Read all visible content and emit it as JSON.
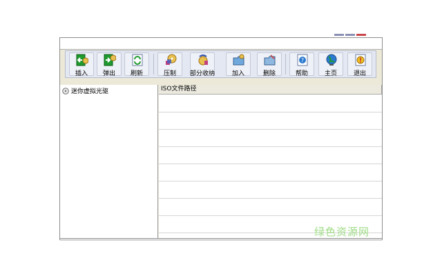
{
  "window": {
    "controls": [
      "minimize",
      "maximize",
      "close"
    ]
  },
  "toolbar": {
    "buttons": [
      {
        "id": "insert",
        "label": "插入",
        "icon": "insert-disc-icon"
      },
      {
        "id": "eject",
        "label": "弹出",
        "icon": "eject-disc-icon"
      },
      {
        "id": "refresh",
        "label": "刷新",
        "icon": "refresh-icon"
      },
      {
        "id": "compress",
        "label": "压制",
        "icon": "compress-disc-icon"
      },
      {
        "id": "partial-collect",
        "label": "部分收纳",
        "icon": "partial-collect-icon"
      },
      {
        "id": "add",
        "label": "加入",
        "icon": "add-folder-icon"
      },
      {
        "id": "delete",
        "label": "删除",
        "icon": "delete-folder-icon"
      },
      {
        "id": "help",
        "label": "帮助",
        "icon": "help-icon"
      },
      {
        "id": "home",
        "label": "主页",
        "icon": "home-globe-icon"
      },
      {
        "id": "exit",
        "label": "退出",
        "icon": "exit-icon"
      }
    ]
  },
  "tree": {
    "root": {
      "label": "迷你虚拟光驱",
      "icon": "cd-drive-icon"
    }
  },
  "list": {
    "columns": [
      "ISO文件路径"
    ],
    "rows": []
  },
  "watermark": "绿色资源网",
  "colors": {
    "toolbar_bg": "#e4e8f3",
    "panel_bg": "#ffffff",
    "watermark": "#9fdc86",
    "close_button": "#c8464a"
  }
}
